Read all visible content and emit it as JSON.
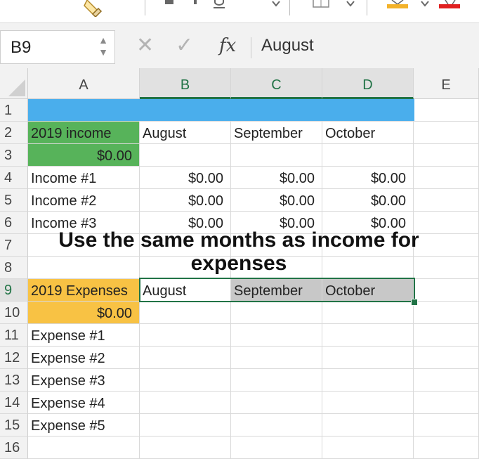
{
  "name_box": {
    "value": "B9"
  },
  "formula_bar": {
    "fx_label": "fx",
    "value": "August"
  },
  "columns": [
    "A",
    "B",
    "C",
    "D",
    "E"
  ],
  "rows": [
    "1",
    "2",
    "3",
    "4",
    "5",
    "6",
    "7",
    "8",
    "9",
    "10",
    "11",
    "12",
    "13",
    "14",
    "15",
    "16"
  ],
  "cells": {
    "A2": "2019 income",
    "B2": "August",
    "C2": "September",
    "D2": "October",
    "A3": "$0.00",
    "A4": "Income #1",
    "B4": "$0.00",
    "C4": "$0.00",
    "D4": "$0.00",
    "A5": "Income #2",
    "B5": "$0.00",
    "C5": "$0.00",
    "D5": "$0.00",
    "A6": "Income #3",
    "B6": "$0.00",
    "C6": "$0.00",
    "D6": "$0.00",
    "A9": "2019 Expenses",
    "B9": "August",
    "C9": "September",
    "D9": "October",
    "A10": "$0.00",
    "A11": "Expense #1",
    "A12": "Expense #2",
    "A13": "Expense #3",
    "A14": "Expense #4",
    "A15": "Expense #5"
  },
  "overlay_annotation": "Use the same months as income for expenses",
  "colors": {
    "row1_fill": "#4aaeec",
    "income_fill": "#57b35a",
    "expense_fill": "#f8c244",
    "selection_gray": "#c8c8c8",
    "selection_border": "#217346"
  },
  "icons": [
    "format-painter-icon",
    "cancel-icon",
    "confirm-icon",
    "function-icon",
    "stepper-icon"
  ]
}
